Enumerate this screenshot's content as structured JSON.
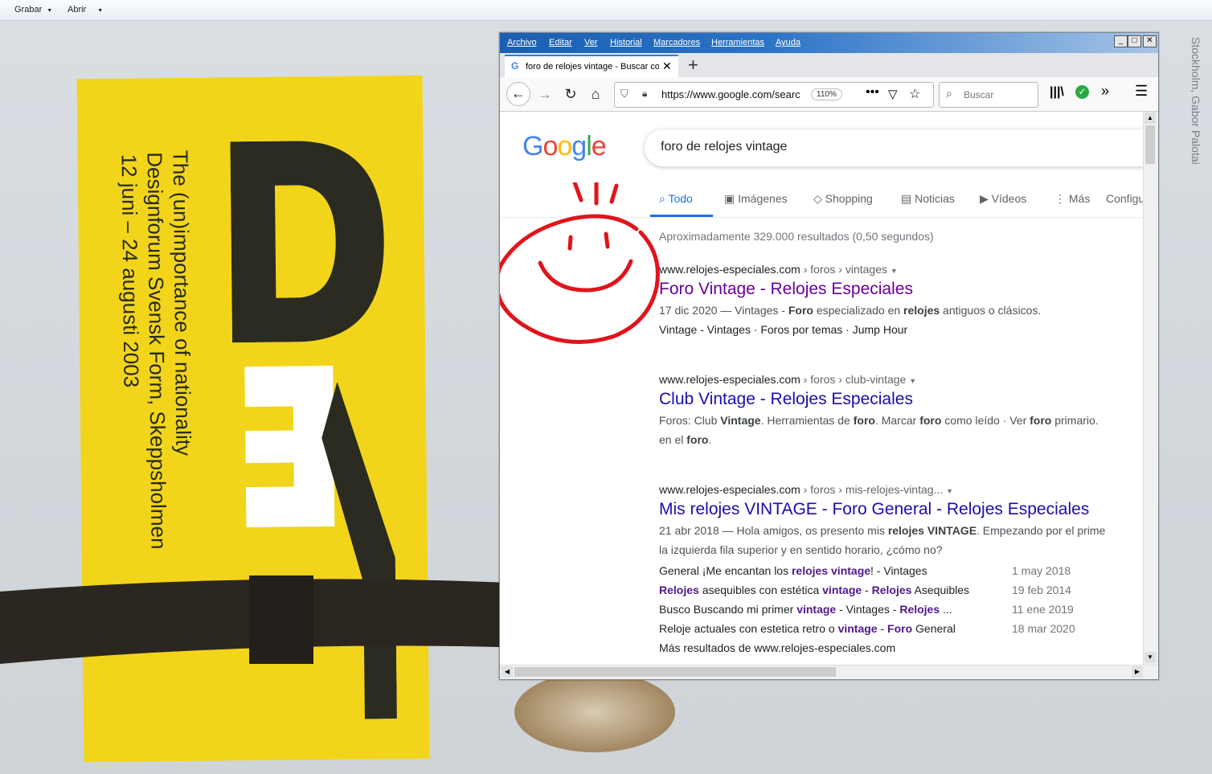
{
  "app_menu": {
    "save_label": "Grabar",
    "open_label": "Abrir"
  },
  "background": {
    "poster_lines": [
      "The (un)importance of nationality",
      "Designforum Svensk Form, Skeppsholmen",
      "12 juni – 24 augusti 2003"
    ],
    "side_caption": "Stockholm, Gabor Palotai",
    "poster_color": "#f2d51a"
  },
  "browser": {
    "menu": [
      "Archivo",
      "Editar",
      "Ver",
      "Historial",
      "Marcadores",
      "Herramientas",
      "Ayuda"
    ],
    "tab_title": "foro de relojes vintage - Buscar co",
    "url": "https://www.google.com/searc",
    "zoom": "110%",
    "search_placeholder": "Buscar"
  },
  "google": {
    "query": "foro de relojes vintage",
    "tabs": [
      "Todo",
      "Imágenes",
      "Shopping",
      "Noticias",
      "Vídeos",
      "Más",
      "Configu"
    ],
    "stats": "Aproximadamente 329.000 resultados (0,50 segundos)",
    "results": [
      {
        "domain": "www.relojes-especiales.com",
        "crumbs": " › foros › vintages",
        "title": "Foro Vintage - Relojes Especiales",
        "snippet_html": "17 dic 2020 — Vintages - <b>Foro</b> especializado en <b>relojes</b> antiguos o clásicos.",
        "snippet2": "Vintage - Vintages · Foros por temas · Jump Hour"
      },
      {
        "domain": "www.relojes-especiales.com",
        "crumbs": " › foros › club-vintage",
        "title": "Club Vintage - Relojes Especiales",
        "snippet_html": "Foros: Club <b>Vintage</b>. Herramientas de <b>foro</b>. Marcar <b>foro</b> como leído · Ver <b>foro</b> primario.",
        "snippet2_html": "en el <b>foro</b>."
      },
      {
        "domain": "www.relojes-especiales.com",
        "crumbs": " › foros › mis-relojes-vintag...",
        "title": "Mis relojes VINTAGE - Foro General - Relojes Especiales",
        "snippet_html": "21 abr 2018 — Hola amigos, os presento mis <b>relojes VINTAGE</b>. Empezando por el prime",
        "snippet2": "la izquierda fila superior y en sentido horario, ¿cómo no?",
        "sublinks": [
          {
            "html": "General ¡Me encantan los <b>relojes vintage</b>! - Vintages",
            "date": "1 may 2018"
          },
          {
            "html": "<b>Relojes</b> asequibles con estética <b>vintage</b> - <b>Relojes</b> Asequibles",
            "date": "19 feb 2014"
          },
          {
            "html": "Busco Buscando mi primer <b>vintage</b> - Vintages - <b>Relojes</b> ...",
            "date": "11 ene 2019"
          },
          {
            "html": "Reloje actuales con estetica retro o <b>vintage</b> - <b>Foro</b> General",
            "date": "18 mar 2020"
          }
        ],
        "more": "Más resultados de www.relojes-especiales.com"
      }
    ]
  },
  "colors": {
    "visited_link": "#660099",
    "link": "#1a0dab",
    "accent": "#1a73e8",
    "annotation": "#e0141b"
  }
}
